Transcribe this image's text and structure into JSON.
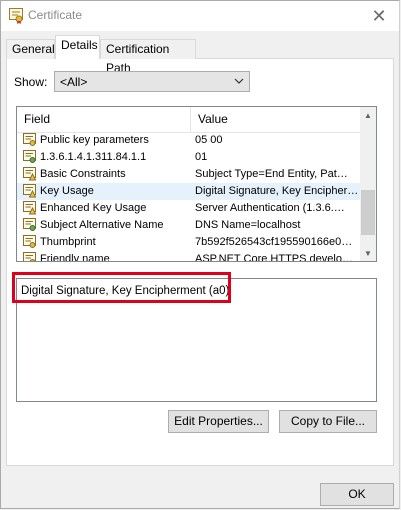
{
  "window": {
    "title": "Certificate",
    "close_label": "✕"
  },
  "tabs": [
    {
      "label": "General"
    },
    {
      "label": "Details"
    },
    {
      "label": "Certification Path"
    }
  ],
  "active_tab": "Details",
  "show": {
    "label": "Show:",
    "value": "<All>"
  },
  "list": {
    "columns": {
      "field": "Field",
      "value": "Value"
    },
    "rows": [
      {
        "icon": "certificate-icon",
        "field": "Public key parameters",
        "value": "05 00"
      },
      {
        "icon": "extension-icon",
        "field": "1.3.6.1.4.1.311.84.1.1",
        "value": "01"
      },
      {
        "icon": "extension-critical-icon",
        "field": "Basic Constraints",
        "value": "Subject Type=End Entity, Pat…"
      },
      {
        "icon": "extension-critical-icon",
        "field": "Key Usage",
        "value": "Digital Signature, Key Encipher…",
        "selected": true
      },
      {
        "icon": "extension-critical-icon",
        "field": "Enhanced Key Usage",
        "value": "Server Authentication (1.3.6.…"
      },
      {
        "icon": "extension-icon",
        "field": "Subject Alternative Name",
        "value": "DNS Name=localhost"
      },
      {
        "icon": "certificate-icon",
        "field": "Thumbprint",
        "value": "7b592f526543cf195590166e0…"
      },
      {
        "icon": "certificate-icon",
        "field": "Friendly name",
        "value": "ASP.NET Core HTTPS develop…"
      }
    ]
  },
  "detail_text": "Digital Signature, Key Encipherment (a0)",
  "buttons": {
    "edit_properties": "Edit Properties...",
    "copy_to_file": "Copy to File...",
    "ok": "OK"
  },
  "colors": {
    "highlight": "#e0001b",
    "selected_row": "#e5f1fb"
  }
}
